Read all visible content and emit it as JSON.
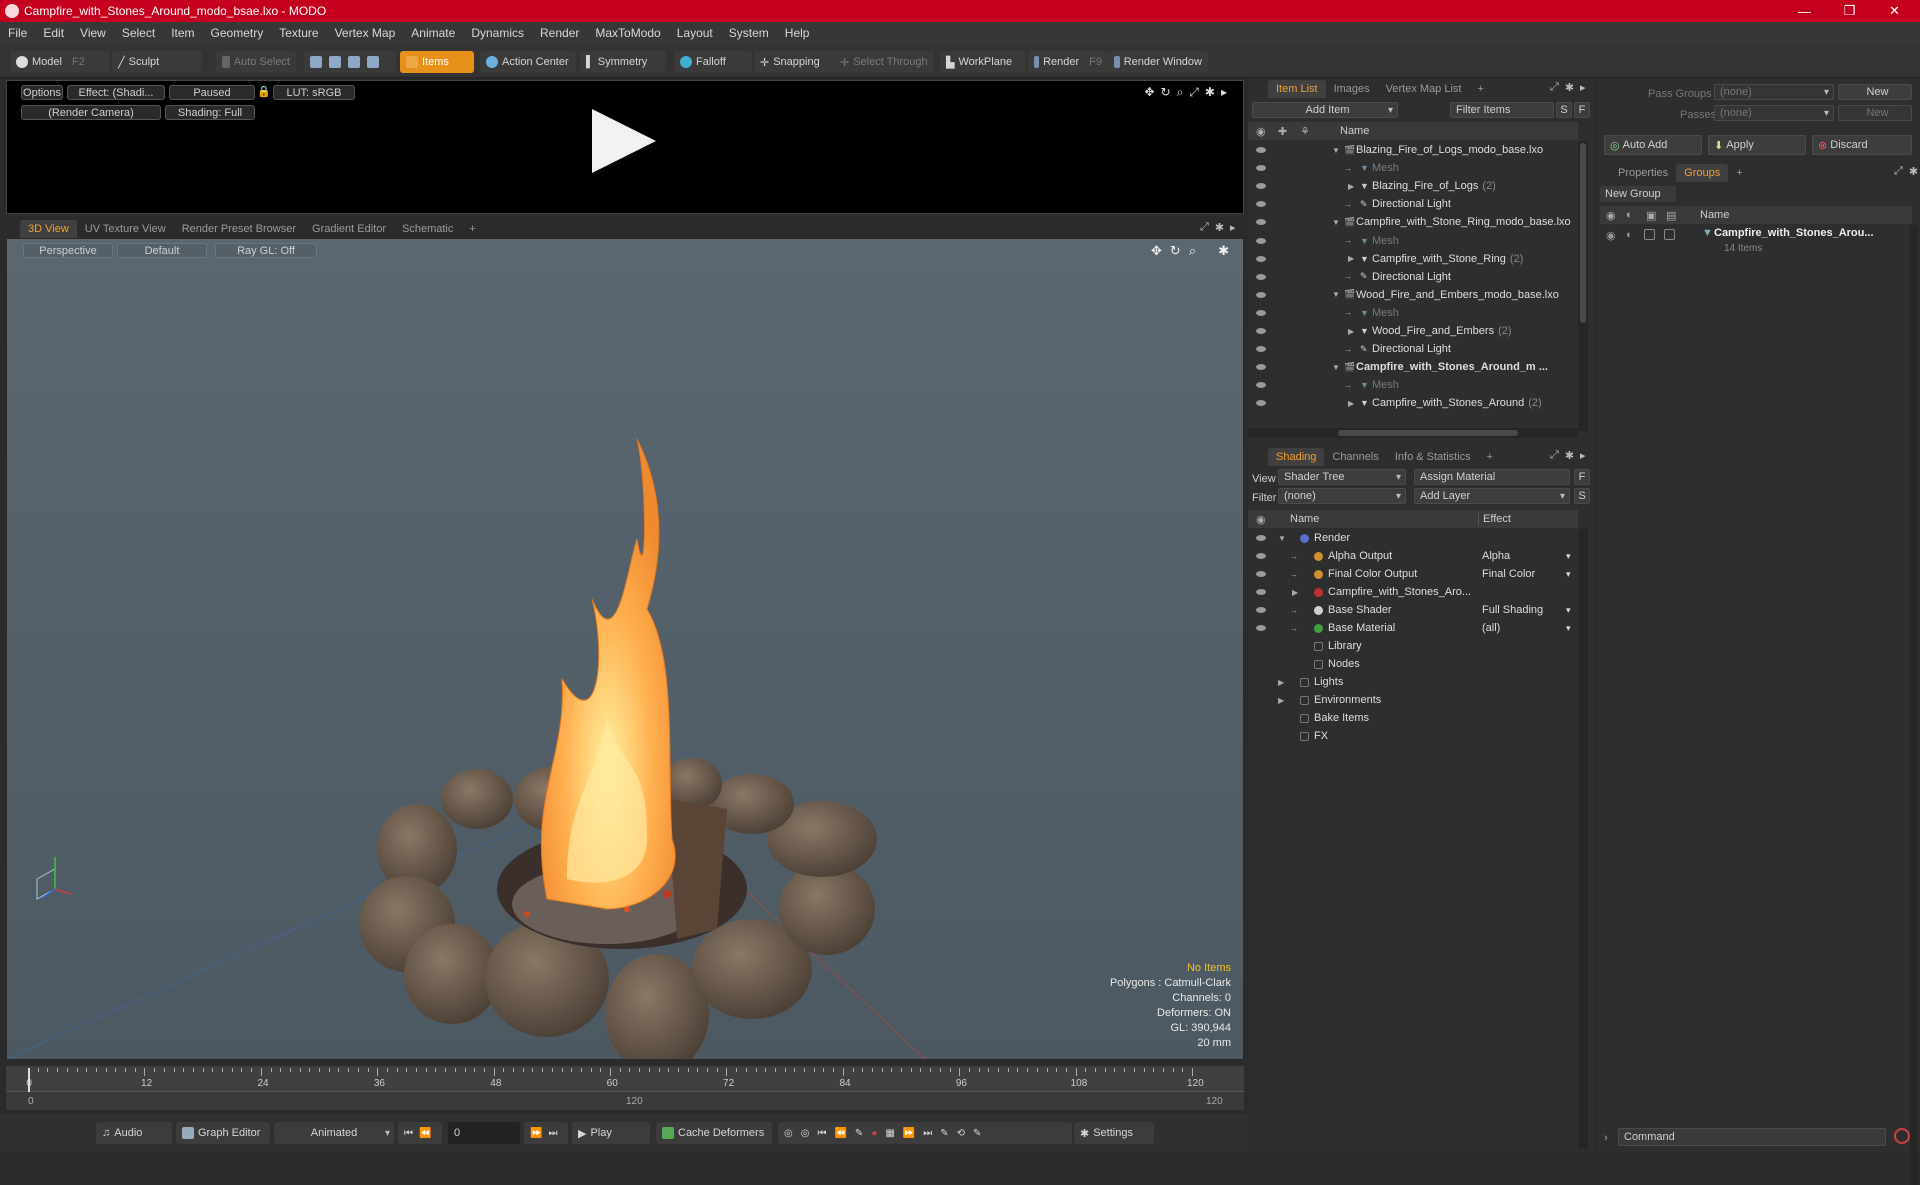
{
  "window": {
    "title": "Campfire_with_Stones_Around_modo_bsae.lxo - MODO",
    "minimize": "—",
    "maximize": "❐",
    "close": "✕"
  },
  "menu": [
    "File",
    "Edit",
    "View",
    "Select",
    "Item",
    "Geometry",
    "Texture",
    "Vertex Map",
    "Animate",
    "Dynamics",
    "Render",
    "MaxToModo",
    "Layout",
    "System",
    "Help"
  ],
  "toolbar": {
    "model": "Model",
    "model_key": "F2",
    "sculpt": "Sculpt",
    "auto_select": "Auto Select",
    "items": "Items",
    "action_center": "Action Center",
    "symmetry": "Symmetry",
    "falloff": "Falloff",
    "snapping": "Snapping",
    "select_through": "Select Through",
    "workplane": "WorkPlane",
    "render": "Render",
    "render_key": "F9",
    "render_window": "Render Window"
  },
  "preview": {
    "options": "Options",
    "effect": "Effect: (Shadi...",
    "paused": "Paused",
    "lut": "LUT: sRGB",
    "camera": "(Render Camera)",
    "shading": "Shading: Full"
  },
  "view_tabs": [
    "3D View",
    "UV Texture View",
    "Render Preset Browser",
    "Gradient Editor",
    "Schematic",
    "+"
  ],
  "viewport": {
    "perspective": "Perspective",
    "default": "Default",
    "raygl": "Ray GL: Off",
    "info": {
      "no_items": "No Items",
      "polygons": "Polygons : Catmull-Clark",
      "channels": "Channels: 0",
      "deformers": "Deformers: ON",
      "gl": "GL: 390,944",
      "scale": "20 mm"
    }
  },
  "timeline": {
    "ticks": [
      "0",
      "12",
      "24",
      "36",
      "48",
      "60",
      "72",
      "84",
      "96",
      "108",
      "120"
    ],
    "lower": [
      "0",
      "120",
      "120"
    ]
  },
  "bottom": {
    "audio": "Audio",
    "graph_editor": "Graph Editor",
    "animated": "Animated",
    "frame": "0",
    "play": "Play",
    "cache": "Cache Deformers",
    "settings": "Settings"
  },
  "item_list": {
    "tabs": [
      "Item List",
      "Images",
      "Vertex Map List",
      "+"
    ],
    "add_item": "Add Item",
    "filter_items": "Filter Items",
    "s": "S",
    "f": "F",
    "name_col": "Name",
    "rows": [
      {
        "label": "Blazing_Fire_of_Logs_modo_base.lxo",
        "indent": 0,
        "tri": "▼",
        "type": "scene"
      },
      {
        "label": "Mesh",
        "indent": 2,
        "tri": "",
        "type": "mesh"
      },
      {
        "label": "Blazing_Fire_of_Logs",
        "count": "(2)",
        "indent": 2,
        "tri": "▶",
        "type": "group"
      },
      {
        "label": "Directional Light",
        "indent": 2,
        "tri": "",
        "type": "light"
      },
      {
        "label": "Campfire_with_Stone_Ring_modo_base.lxo",
        "indent": 0,
        "tri": "▼",
        "type": "scene"
      },
      {
        "label": "Mesh",
        "indent": 2,
        "tri": "",
        "type": "mesh"
      },
      {
        "label": "Campfire_with_Stone_Ring",
        "count": "(2)",
        "indent": 2,
        "tri": "▶",
        "type": "group"
      },
      {
        "label": "Directional Light",
        "indent": 2,
        "tri": "",
        "type": "light"
      },
      {
        "label": "Wood_Fire_and_Embers_modo_base.lxo",
        "indent": 0,
        "tri": "▼",
        "type": "scene"
      },
      {
        "label": "Mesh",
        "indent": 2,
        "tri": "",
        "type": "mesh"
      },
      {
        "label": "Wood_Fire_and_Embers",
        "count": "(2)",
        "indent": 2,
        "tri": "▶",
        "type": "group"
      },
      {
        "label": "Directional Light",
        "indent": 2,
        "tri": "",
        "type": "light"
      },
      {
        "label": "Campfire_with_Stones_Around_m ...",
        "indent": 0,
        "tri": "▼",
        "type": "scene-bold"
      },
      {
        "label": "Mesh",
        "indent": 2,
        "tri": "",
        "type": "mesh"
      },
      {
        "label": "Campfire_with_Stones_Around",
        "count": "(2)",
        "indent": 2,
        "tri": "▶",
        "type": "group"
      }
    ]
  },
  "shading": {
    "tabs": [
      "Shading",
      "Channels",
      "Info & Statistics",
      "+"
    ],
    "view_label": "View",
    "view_value": "Shader Tree",
    "assign_material": "Assign Material",
    "f": "F",
    "filter_label": "Filter",
    "filter_value": "(none)",
    "add_layer": "Add Layer",
    "s": "S",
    "name_col": "Name",
    "effect_col": "Effect",
    "rows": [
      {
        "label": "Render",
        "effect": "",
        "indent": 0,
        "tri": "▼",
        "color": "#5a6fd0"
      },
      {
        "label": "Alpha Output",
        "effect": "Alpha",
        "indent": 1,
        "tri": "",
        "color": "#d09030"
      },
      {
        "label": "Final Color Output",
        "effect": "Final Color",
        "indent": 1,
        "tri": "",
        "color": "#d09030"
      },
      {
        "label": "Campfire_with_Stones_Aro...",
        "effect": "",
        "indent": 1,
        "tri": "▶",
        "color": "#c03030"
      },
      {
        "label": "Base Shader",
        "effect": "Full Shading",
        "indent": 1,
        "tri": "",
        "color": "#d0d0d0"
      },
      {
        "label": "Base Material",
        "effect": "(all)",
        "indent": 1,
        "tri": "",
        "color": "#40a040"
      },
      {
        "label": "Library",
        "effect": "",
        "indent": 1,
        "tri": "",
        "color": ""
      },
      {
        "label": "Nodes",
        "effect": "",
        "indent": 1,
        "tri": "",
        "color": ""
      },
      {
        "label": "Lights",
        "effect": "",
        "indent": 0,
        "tri": "▶",
        "color": ""
      },
      {
        "label": "Environments",
        "effect": "",
        "indent": 0,
        "tri": "▶",
        "color": ""
      },
      {
        "label": "Bake Items",
        "effect": "",
        "indent": 0,
        "tri": "",
        "color": ""
      },
      {
        "label": "FX",
        "effect": "",
        "indent": 0,
        "tri": "",
        "color": ""
      }
    ]
  },
  "groups_panel": {
    "pass_groups_label": "Pass Groups",
    "pass_groups_value": "(none)",
    "new": "New",
    "passes_label": "Passes",
    "passes_value": "(none)",
    "new2": "New",
    "auto_add": "Auto Add",
    "apply": "Apply",
    "discard": "Discard",
    "tabs": [
      "Properties",
      "Groups",
      "+"
    ],
    "new_group": "New Group",
    "name_col": "Name",
    "group_name": "Campfire_with_Stones_Arou...",
    "group_count": "14 Items",
    "command": "Command"
  },
  "colors": {
    "accent": "#f0a030",
    "titlebar": "#c5001e"
  }
}
